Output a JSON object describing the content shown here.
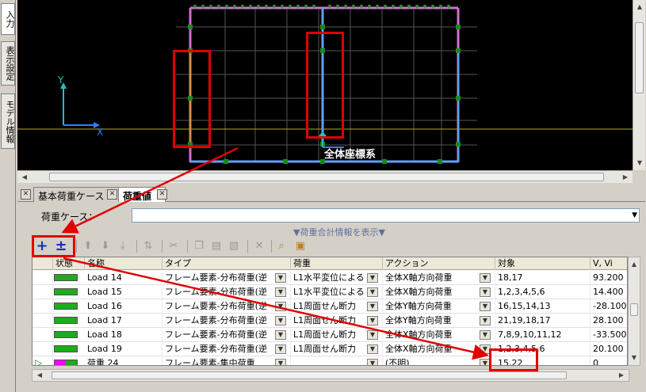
{
  "side_tabs": [
    "入力",
    "表示設定",
    "モデル情報"
  ],
  "view": {
    "axis_y": "Y",
    "axis_x": "X",
    "coord_label": "全体座標系"
  },
  "tabs": {
    "base_case": "基本荷重ケース",
    "load_value": "荷重値"
  },
  "load_case": {
    "label": "荷重ケース：",
    "value": ""
  },
  "summary_link": "▼荷重合計情報を表示▼",
  "grid": {
    "columns": [
      "状態",
      "名称",
      "タイプ",
      "荷重",
      "アクション",
      "対象",
      "V, Vi"
    ],
    "rows": [
      {
        "name": "Load 14",
        "type": "フレーム要素-分布荷重(逆",
        "load": "L1水平変位による",
        "action": "全体X軸方向荷重",
        "target": "18,17",
        "value": "93.200",
        "status": "normal"
      },
      {
        "name": "Load 15",
        "type": "フレーム要素-分布荷重(逆",
        "load": "L1水平変位による",
        "action": "全体X軸方向荷重",
        "target": "1,2,3,4,5,6",
        "value": "14.400",
        "status": "normal"
      },
      {
        "name": "Load 16",
        "type": "フレーム要素-分布荷重(逆",
        "load": "L1周面せん断力",
        "action": "全体Y軸方向荷重",
        "target": "16,15,14,13",
        "value": "-28.100",
        "status": "normal"
      },
      {
        "name": "Load 17",
        "type": "フレーム要素-分布荷重(逆",
        "load": "L1周面せん断力",
        "action": "全体Y軸方向荷重",
        "target": "21,19,18,17",
        "value": "28.100",
        "status": "normal"
      },
      {
        "name": "Load 18",
        "type": "フレーム要素-分布荷重(逆",
        "load": "L1周面せん断力",
        "action": "全体X軸方向荷重",
        "target": "7,8,9,10,11,12",
        "value": "-33.500",
        "status": "normal"
      },
      {
        "name": "Load 19",
        "type": "フレーム要素-分布荷重(逆",
        "load": "L1周面せん断力",
        "action": "全体X軸方向荷重",
        "target": "1,2,3,4,5,6",
        "value": "20.100",
        "status": "normal"
      },
      {
        "name": "荷重 24",
        "type": "フレーム要素-集中荷重",
        "load": "",
        "action": "(不明)",
        "target": "15,22",
        "value": "0",
        "status": "new"
      }
    ]
  },
  "colors": {
    "status_green": "#1faa1f",
    "status_new": "#ff00ff",
    "annotation_red": "#e00000",
    "view_bg": "#000000"
  },
  "toolbar_icons": [
    "add-icon",
    "add-insert-icon",
    "move-up-icon",
    "move-down-icon",
    "move-bottom-icon",
    "sort-icon",
    "scissors-icon",
    "copy-icon",
    "paste-icon",
    "paste-special-icon",
    "delete-icon",
    "zoom-icon",
    "filter-icon"
  ]
}
